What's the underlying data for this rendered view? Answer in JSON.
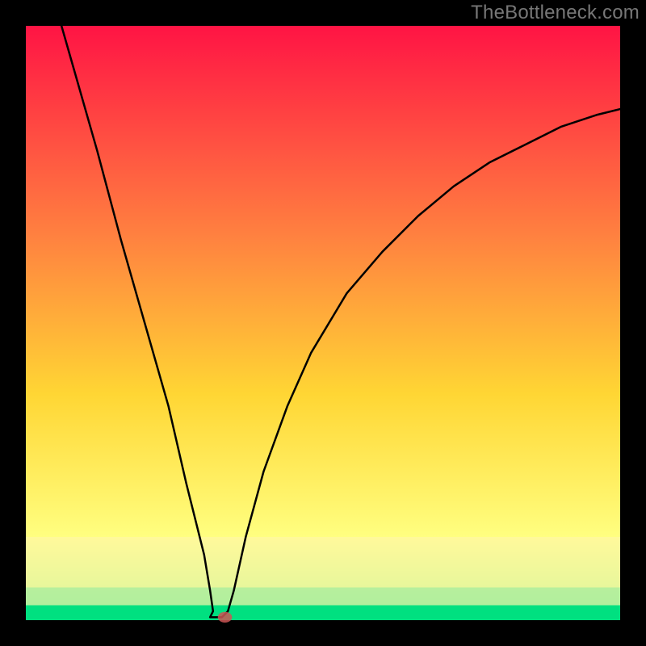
{
  "watermark": "TheBottleneck.com",
  "chart_data": {
    "type": "line",
    "title": "",
    "xlabel": "",
    "ylabel": "",
    "xlim": [
      0,
      100
    ],
    "ylim": [
      0,
      100
    ],
    "axes_visible": false,
    "background_gradient": {
      "top": "#ff1444",
      "mid_upper": "#ff8040",
      "mid": "#ffd634",
      "mid_lower": "#ffff80",
      "bottom": "#00e080"
    },
    "band_colors": {
      "yellow_band": "#fff8a0",
      "light_green": "#c0f0a0",
      "green": "#00e080"
    },
    "series": [
      {
        "name": "bottleneck-curve",
        "color": "#000000",
        "stroke_width": 2.5,
        "points": [
          {
            "x": 6,
            "y": 100
          },
          {
            "x": 8,
            "y": 93
          },
          {
            "x": 12,
            "y": 79
          },
          {
            "x": 16,
            "y": 64
          },
          {
            "x": 20,
            "y": 50
          },
          {
            "x": 24,
            "y": 36
          },
          {
            "x": 27,
            "y": 23
          },
          {
            "x": 30,
            "y": 11
          },
          {
            "x": 31,
            "y": 5
          },
          {
            "x": 31.5,
            "y": 1.5
          },
          {
            "x": 31,
            "y": 0.5
          },
          {
            "x": 33,
            "y": 0.5
          },
          {
            "x": 34,
            "y": 1.5
          },
          {
            "x": 35,
            "y": 5
          },
          {
            "x": 37,
            "y": 14
          },
          {
            "x": 40,
            "y": 25
          },
          {
            "x": 44,
            "y": 36
          },
          {
            "x": 48,
            "y": 45
          },
          {
            "x": 54,
            "y": 55
          },
          {
            "x": 60,
            "y": 62
          },
          {
            "x": 66,
            "y": 68
          },
          {
            "x": 72,
            "y": 73
          },
          {
            "x": 78,
            "y": 77
          },
          {
            "x": 84,
            "y": 80
          },
          {
            "x": 90,
            "y": 83
          },
          {
            "x": 96,
            "y": 85
          },
          {
            "x": 100,
            "y": 86
          }
        ]
      }
    ],
    "marker": {
      "x": 33.5,
      "y": 0.5,
      "rx": 1.2,
      "ry": 0.9,
      "color": "#cc5555"
    },
    "border": {
      "color": "#000000",
      "width": 32
    }
  }
}
